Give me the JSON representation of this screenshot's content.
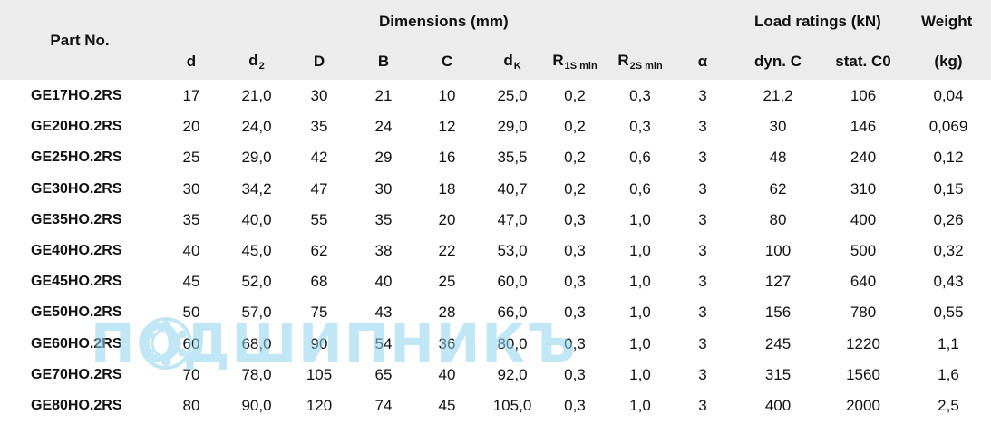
{
  "header": {
    "part_no": "Part No.",
    "dimensions": "Dimensions (mm)",
    "load_ratings": "Load ratings (kN)",
    "weight": "Weight",
    "weight_unit": "(kg)"
  },
  "columns": [
    {
      "main": "d",
      "sub": ""
    },
    {
      "main": "d",
      "sub": "2"
    },
    {
      "main": "D",
      "sub": ""
    },
    {
      "main": "B",
      "sub": ""
    },
    {
      "main": "C",
      "sub": ""
    },
    {
      "main": "d",
      "sub": "K"
    },
    {
      "main": "R",
      "sub": "1S min"
    },
    {
      "main": "R",
      "sub": "2S min"
    },
    {
      "main": "α",
      "sub": ""
    },
    {
      "main": "dyn. C",
      "sub": ""
    },
    {
      "main": "stat. C0",
      "sub": ""
    }
  ],
  "rows": [
    {
      "part": "GE17HO.2RS",
      "values": [
        "17",
        "21,0",
        "30",
        "21",
        "10",
        "25,0",
        "0,2",
        "0,3",
        "3",
        "21,2",
        "106",
        "0,04"
      ]
    },
    {
      "part": "GE20HO.2RS",
      "values": [
        "20",
        "24,0",
        "35",
        "24",
        "12",
        "29,0",
        "0,2",
        "0,3",
        "3",
        "30",
        "146",
        "0,069"
      ]
    },
    {
      "part": "GE25HO.2RS",
      "values": [
        "25",
        "29,0",
        "42",
        "29",
        "16",
        "35,5",
        "0,2",
        "0,6",
        "3",
        "48",
        "240",
        "0,12"
      ]
    },
    {
      "part": "GE30HO.2RS",
      "values": [
        "30",
        "34,2",
        "47",
        "30",
        "18",
        "40,7",
        "0,2",
        "0,6",
        "3",
        "62",
        "310",
        "0,15"
      ]
    },
    {
      "part": "GE35HO.2RS",
      "values": [
        "35",
        "40,0",
        "55",
        "35",
        "20",
        "47,0",
        "0,3",
        "1,0",
        "3",
        "80",
        "400",
        "0,26"
      ]
    },
    {
      "part": "GE40HO.2RS",
      "values": [
        "40",
        "45,0",
        "62",
        "38",
        "22",
        "53,0",
        "0,3",
        "1,0",
        "3",
        "100",
        "500",
        "0,32"
      ]
    },
    {
      "part": "GE45HO.2RS",
      "values": [
        "45",
        "52,0",
        "68",
        "40",
        "25",
        "60,0",
        "0,3",
        "1,0",
        "3",
        "127",
        "640",
        "0,43"
      ]
    },
    {
      "part": "GE50HO.2RS",
      "values": [
        "50",
        "57,0",
        "75",
        "43",
        "28",
        "66,0",
        "0,3",
        "1,0",
        "3",
        "156",
        "780",
        "0,55"
      ]
    },
    {
      "part": "GE60HO.2RS",
      "values": [
        "60",
        "68,0",
        "90",
        "54",
        "36",
        "80,0",
        "0,3",
        "1,0",
        "3",
        "245",
        "1220",
        "1,1"
      ]
    },
    {
      "part": "GE70HO.2RS",
      "values": [
        "70",
        "78,0",
        "105",
        "65",
        "40",
        "92,0",
        "0,3",
        "1,0",
        "3",
        "315",
        "1560",
        "1,6"
      ]
    },
    {
      "part": "GE80HO.2RS",
      "values": [
        "80",
        "90,0",
        "120",
        "74",
        "45",
        "105,0",
        "0,3",
        "1,0",
        "3",
        "400",
        "2000",
        "2,5"
      ]
    }
  ],
  "watermark": {
    "text": "ПОДШИПНИКЪ",
    "color": "#8fd3ee"
  },
  "colors": {
    "header_background": "#ececec",
    "text": "#111111"
  }
}
